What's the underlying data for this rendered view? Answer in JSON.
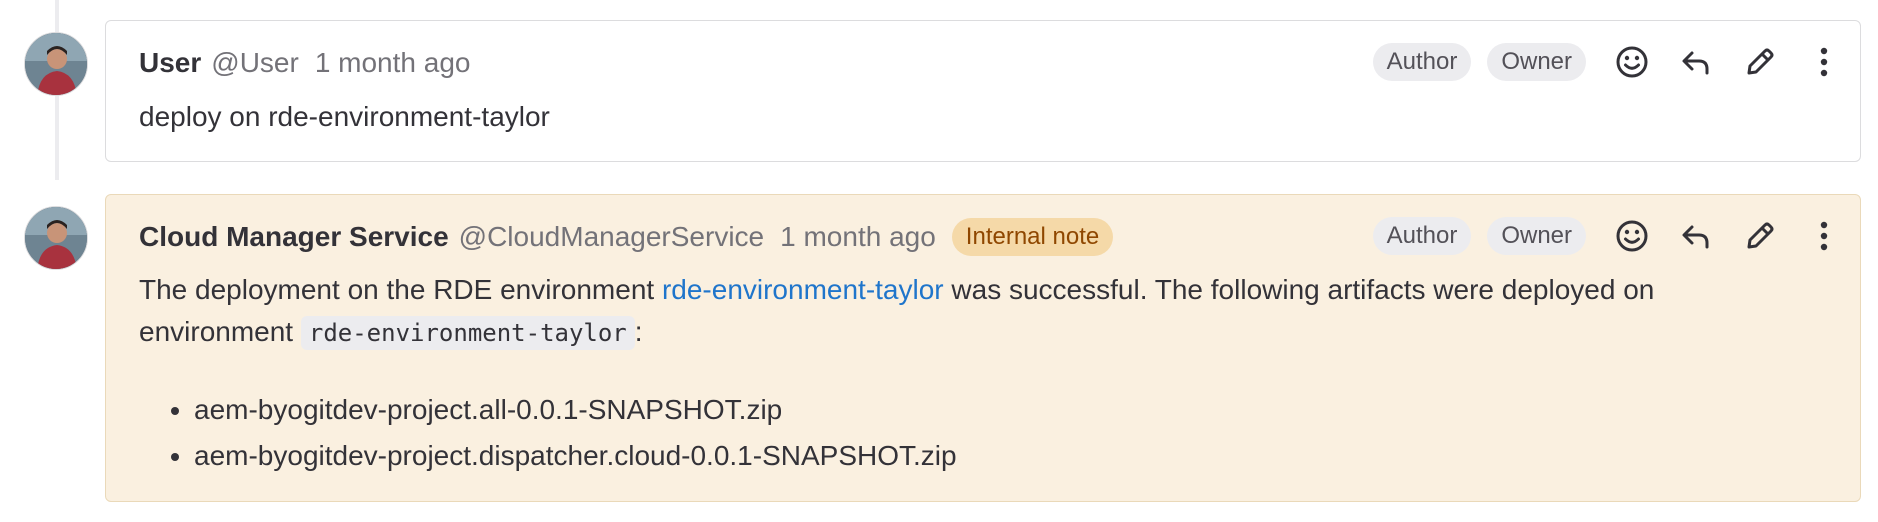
{
  "notes": [
    {
      "author_name": "User",
      "author_handle": "@User",
      "timestamp": "1 month ago",
      "badges": [
        "Author",
        "Owner"
      ],
      "body": "deploy on rde-environment-taylor",
      "actions": [
        "smiley-icon",
        "reply-icon",
        "pencil-icon",
        "kebab-menu-icon"
      ]
    },
    {
      "author_name": "Cloud Manager Service",
      "author_handle": "@CloudManagerService",
      "timestamp": "1 month ago",
      "internal_badge": "Internal note",
      "badges": [
        "Author",
        "Owner"
      ],
      "body_prefix": "The deployment on the RDE environment ",
      "body_link": "rde-environment-taylor",
      "body_middle": " was successful. The following artifacts were deployed on environment ",
      "body_code": "rde-environment-taylor",
      "body_suffix": ":",
      "artifacts": [
        "aem-byogitdev-project.all-0.0.1-SNAPSHOT.zip",
        "aem-byogitdev-project.dispatcher.cloud-0.0.1-SNAPSHOT.zip"
      ],
      "actions": [
        "smiley-icon",
        "reply-icon",
        "pencil-icon",
        "kebab-menu-icon"
      ]
    }
  ],
  "colors": {
    "internal_note_bg": "#faf0e0",
    "internal_badge_bg": "#f5d9a8",
    "link": "#1f75cb"
  }
}
